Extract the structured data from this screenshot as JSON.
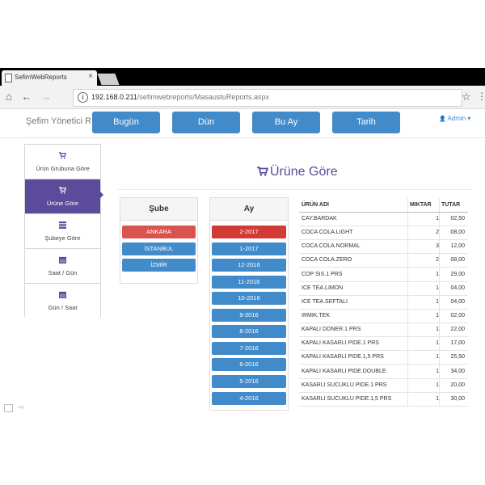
{
  "browser": {
    "tab_title": "SefimWebReports",
    "tab_close": "×",
    "back_icon": "←",
    "forward_icon": "→",
    "home_icon": "⌂",
    "url_host": "192.168.0.211",
    "url_path": "/sefimwebreports/MasaustuReports.aspx",
    "info_icon": "i",
    "star_icon": "☆",
    "menu_icon": "⋮"
  },
  "navbar": {
    "brand": "Şefim Yönetici RP",
    "periods": [
      "Bugün",
      "Dün",
      "Bu Ay",
      "Tarih"
    ],
    "user": "Admin",
    "user_icon": "👤",
    "caret": "▾"
  },
  "sidebar": {
    "items": [
      {
        "label": "Ürün Grubuna Göre",
        "icon": "cart-icon"
      },
      {
        "label": "Ürüne Göre",
        "icon": "cart-icon",
        "active": true
      },
      {
        "label": "Şubeye Göre",
        "icon": "server-icon"
      },
      {
        "label": "Saat / Gün",
        "icon": "calendar-icon"
      },
      {
        "label": "Gün / Saat",
        "icon": "calendar-icon"
      }
    ]
  },
  "main": {
    "title": "Ürüne Göre"
  },
  "branch_panel": {
    "title": "Şube",
    "items": [
      {
        "label": "ANKARA",
        "selected": true
      },
      {
        "label": "İSTANBUL",
        "selected": false
      },
      {
        "label": "İZMİR",
        "selected": false
      }
    ]
  },
  "month_panel": {
    "title": "Ay",
    "items": [
      {
        "label": "2-2017",
        "selected": true
      },
      {
        "label": "1-2017",
        "selected": false
      },
      {
        "label": "12-2016",
        "selected": false
      },
      {
        "label": "11-2016",
        "selected": false
      },
      {
        "label": "10-2016",
        "selected": false
      },
      {
        "label": "9-2016",
        "selected": false
      },
      {
        "label": "8-2016",
        "selected": false
      },
      {
        "label": "7-2016",
        "selected": false
      },
      {
        "label": "6-2016",
        "selected": false
      },
      {
        "label": "5-2016",
        "selected": false
      },
      {
        "label": "4-2016",
        "selected": false
      }
    ]
  },
  "table": {
    "headers": [
      "ÜRÜN ADI",
      "MIKTAR",
      "TUTAR"
    ],
    "rows": [
      [
        "CAY.BARDAK",
        "1",
        "02,50"
      ],
      [
        "COCA COLA.LIGHT",
        "2",
        "08,00"
      ],
      [
        "COCA COLA.NORMAL",
        "3",
        "12,00"
      ],
      [
        "COCA COLA.ZERO",
        "2",
        "08,00"
      ],
      [
        "COP SIS.1 PRS",
        "1",
        "29,00"
      ],
      [
        "ICE TEA.LIMON",
        "1",
        "04,00"
      ],
      [
        "ICE TEA.SEFTALI",
        "1",
        "04,00"
      ],
      [
        "IRMIK.TEK",
        "1",
        "02,00"
      ],
      [
        "KAPALI DONER.1 PRS",
        "1",
        "22,00"
      ],
      [
        "KAPALI KASARLI PIDE.1 PRS",
        "1",
        "17,00"
      ],
      [
        "KAPALI KASARLI PIDE.1,5 PRS",
        "1",
        "25,50"
      ],
      [
        "KAPALI KASARLI PIDE.DOUBLE",
        "1",
        "34,00"
      ],
      [
        "KASARLI SUCUKLU PIDE.1 PRS",
        "1",
        "20,00"
      ],
      [
        "KASARLI SUCUKLU PIDE.1,5 PRS",
        "1",
        "30,00"
      ]
    ]
  },
  "colors": {
    "primary": "#428bca",
    "accent": "#5c4b9b",
    "danger": "#d9534f"
  }
}
